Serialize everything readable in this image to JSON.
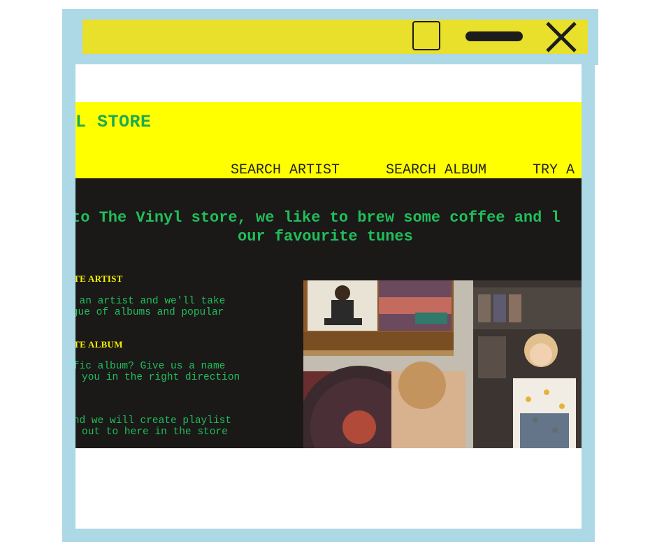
{
  "window": {
    "maximize_icon": "square-outline-icon",
    "minimize_icon": "bar-icon",
    "close_icon": "x-icon"
  },
  "site": {
    "brand": "VINYL STORE",
    "nav": {
      "search_artist": "SEARCH ARTIST",
      "search_album": "SEARCH ALBUM",
      "try": "TRY A"
    },
    "welcome": {
      "line1": "to The Vinyl store, we like to brew some coffee and l",
      "line2": "our favourite tunes"
    },
    "sections": {
      "artist_heading": "OURITE ARTIST",
      "artist_text_1": "e of an artist and we'll take",
      "artist_text_2": "talogue of albums and popular",
      "album_heading": "OURITE ALBUM",
      "album_text_1": "pecific album? Give us a name",
      "album_text_2": "you in the right direction",
      "try_text_1": "ts and we will create playlist",
      "try_text_2": "out to here in the store"
    },
    "image": {
      "description_icon": "record-store-collage-image"
    }
  },
  "colors": {
    "frame": "#add8e6",
    "titlebar": "#e8e02a",
    "header": "#ffff00",
    "content_bg": "#1b1818",
    "accent_green": "#1fbf5a",
    "heading_yellow": "#f2f200"
  }
}
